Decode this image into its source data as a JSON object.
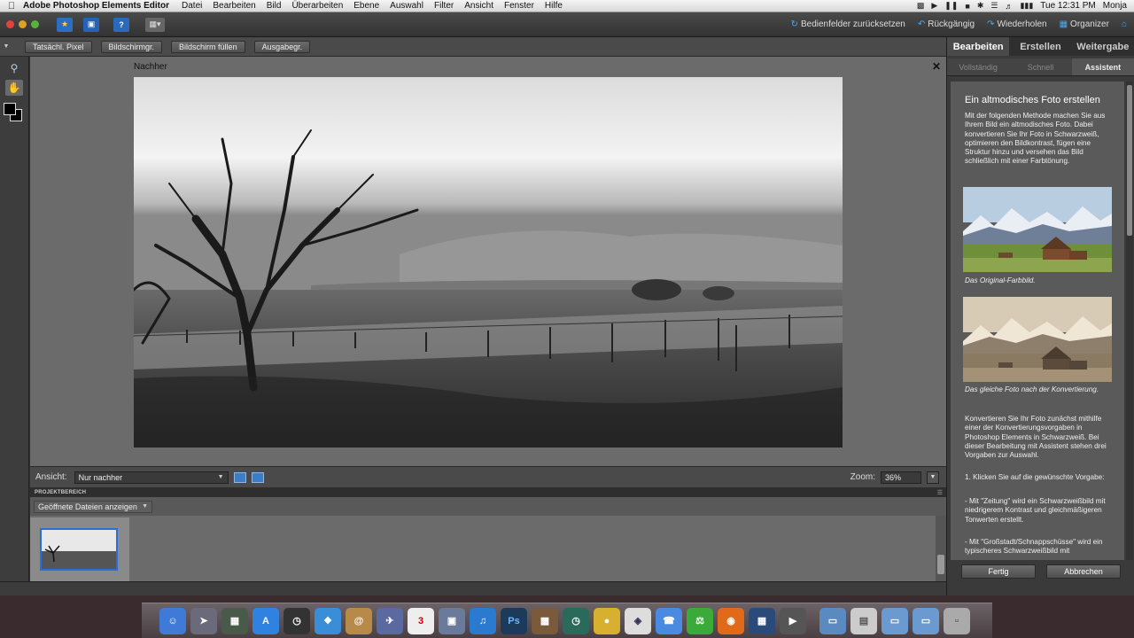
{
  "menubar": {
    "app_name": "Adobe Photoshop Elements Editor",
    "menus": [
      "Datei",
      "Bearbeiten",
      "Bild",
      "Überarbeiten",
      "Ebene",
      "Auswahl",
      "Filter",
      "Ansicht",
      "Fenster",
      "Hilfe"
    ],
    "clock": "Tue 12:31 PM",
    "user": "Monja"
  },
  "toolbar": {
    "reset_panels": "Bedienfelder zurücksetzen",
    "undo": "Rückgängig",
    "redo": "Wiederholen",
    "organizer": "Organizer"
  },
  "options": {
    "buttons": [
      "Tatsächl. Pixel",
      "Bildschirmgr.",
      "Bildschirm füllen",
      "Ausgabegr."
    ]
  },
  "document": {
    "label": "Nachher"
  },
  "viewbar": {
    "label": "Ansicht:",
    "view_value": "Nur nachher",
    "zoom_label": "Zoom:",
    "zoom_value": "36%"
  },
  "project": {
    "header": "PROJEKTBEREICH",
    "filter_value": "Geöffnete Dateien anzeigen"
  },
  "panel": {
    "tabs": [
      "Bearbeiten",
      "Erstellen",
      "Weitergabe"
    ],
    "subtabs": [
      "Vollständig",
      "Schnell",
      "Assistent"
    ],
    "guide_title": "Ein altmodisches Foto erstellen",
    "intro": "Mit der folgenden Methode machen Sie aus Ihrem Bild ein altmodisches Foto. Dabei konvertieren Sie Ihr Foto in Schwarzweiß, optimieren den Bildkontrast, fügen eine Struktur hinzu und versehen das Bild schließlich mit einer Farbtönung.",
    "caption1": "Das Original-Farbbild.",
    "caption2": "Das gleiche Foto nach der Konvertierung.",
    "step_text": "Konvertieren Sie Ihr Foto zunächst mithilfe einer der Konvertierungsvorgaben in Photoshop Elements in Schwarzweiß. Bei dieser Bearbeitung mit Assistent stehen drei Vorgaben zur Auswahl.",
    "step1": "1. Klicken Sie auf die gewünschte Vorgabe:",
    "bullet1": "- Mit \"Zeitung\" wird ein Schwarzweißbild mit niedrigerem Kontrast und gleichmäßigeren Tonwerten erstellt.",
    "bullet2": "- Mit \"Großstadt/Schnappschüsse\" wird ein typischeres Schwarzweißbild mit",
    "done": "Fertig",
    "cancel": "Abbrechen"
  },
  "colors": {
    "accent": "#2a6fd6",
    "panel_bg": "#5a5a5a"
  }
}
